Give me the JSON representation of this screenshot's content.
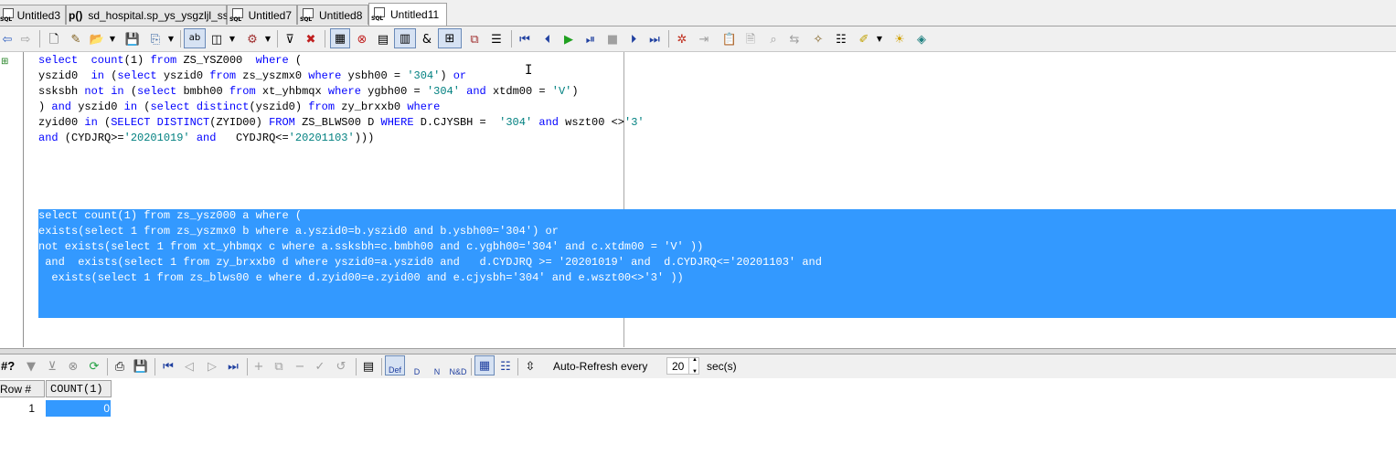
{
  "tabs": [
    {
      "label": "Untitled3",
      "icon": "sql-file-icon"
    },
    {
      "label": "sd_hospital.sp_ys_ysgzljl_ss",
      "icon": "procedure-icon",
      "icon_text": "p()"
    },
    {
      "label": "Untitled7",
      "icon": "sql-file-icon"
    },
    {
      "label": "Untitled8",
      "icon": "sql-file-icon"
    },
    {
      "label": "Untitled11",
      "icon": "sql-file-icon",
      "active": true
    }
  ],
  "sql_icon_text": "SQL",
  "editor": {
    "query1": [
      [
        {
          "t": "select  ",
          "c": "kw"
        },
        {
          "t": "count",
          "c": "fn"
        },
        {
          "t": "(1) ",
          "c": ""
        },
        {
          "t": "from",
          "c": "kw"
        },
        {
          "t": " ZS_YSZ000  ",
          "c": ""
        },
        {
          "t": "where",
          "c": "kw"
        },
        {
          "t": " (",
          "c": ""
        }
      ],
      [
        {
          "t": "yszid0  ",
          "c": ""
        },
        {
          "t": "in",
          "c": "kw"
        },
        {
          "t": " (",
          "c": ""
        },
        {
          "t": "select",
          "c": "kw"
        },
        {
          "t": " yszid0 ",
          "c": ""
        },
        {
          "t": "from",
          "c": "kw"
        },
        {
          "t": " zs_yszmx0 ",
          "c": ""
        },
        {
          "t": "where",
          "c": "kw"
        },
        {
          "t": " ysbh00 = ",
          "c": ""
        },
        {
          "t": "'304'",
          "c": "str"
        },
        {
          "t": ") ",
          "c": ""
        },
        {
          "t": "or",
          "c": "kw"
        }
      ],
      [
        {
          "t": "ssksbh ",
          "c": ""
        },
        {
          "t": "not in",
          "c": "kw"
        },
        {
          "t": " (",
          "c": ""
        },
        {
          "t": "select",
          "c": "kw"
        },
        {
          "t": " bmbh00 ",
          "c": ""
        },
        {
          "t": "from",
          "c": "kw"
        },
        {
          "t": " xt_yhbmqx ",
          "c": ""
        },
        {
          "t": "where",
          "c": "kw"
        },
        {
          "t": " ygbh00 = ",
          "c": ""
        },
        {
          "t": "'304'",
          "c": "str"
        },
        {
          "t": " ",
          "c": ""
        },
        {
          "t": "and",
          "c": "kw"
        },
        {
          "t": " xtdm00 = ",
          "c": ""
        },
        {
          "t": "'V'",
          "c": "str"
        },
        {
          "t": ")",
          "c": ""
        }
      ],
      [
        {
          "t": ") ",
          "c": ""
        },
        {
          "t": "and",
          "c": "kw"
        },
        {
          "t": " yszid0 ",
          "c": ""
        },
        {
          "t": "in",
          "c": "kw"
        },
        {
          "t": " (",
          "c": ""
        },
        {
          "t": "select distinct",
          "c": "kw"
        },
        {
          "t": "(yszid0) ",
          "c": ""
        },
        {
          "t": "from",
          "c": "kw"
        },
        {
          "t": " zy_brxxb0 ",
          "c": ""
        },
        {
          "t": "where",
          "c": "kw"
        }
      ],
      [
        {
          "t": "zyid00 ",
          "c": ""
        },
        {
          "t": "in",
          "c": "kw"
        },
        {
          "t": " (",
          "c": ""
        },
        {
          "t": "SELECT DISTINCT",
          "c": "kw"
        },
        {
          "t": "(ZYID00) ",
          "c": ""
        },
        {
          "t": "FROM",
          "c": "kw"
        },
        {
          "t": " ZS_BLWS00 D ",
          "c": ""
        },
        {
          "t": "WHERE",
          "c": "kw"
        },
        {
          "t": " D.CJYSBH =  ",
          "c": ""
        },
        {
          "t": "'304'",
          "c": "str"
        },
        {
          "t": " ",
          "c": ""
        },
        {
          "t": "and",
          "c": "kw"
        },
        {
          "t": " wszt00 <>",
          "c": ""
        },
        {
          "t": "'3'",
          "c": "str"
        }
      ],
      [
        {
          "t": "and",
          "c": "kw"
        },
        {
          "t": " (CYDJRQ>=",
          "c": ""
        },
        {
          "t": "'20201019'",
          "c": "str"
        },
        {
          "t": " ",
          "c": ""
        },
        {
          "t": "and",
          "c": "kw"
        },
        {
          "t": "   CYDJRQ<=",
          "c": ""
        },
        {
          "t": "'20201103'",
          "c": "str"
        },
        {
          "t": ")))",
          "c": ""
        }
      ]
    ],
    "query2": [
      "select count(1) from zs_ysz000 a where (",
      "exists(select 1 from zs_yszmx0 b where a.yszid0=b.yszid0 and b.ysbh00='304') or",
      "not exists(select 1 from xt_yhbmqx c where a.ssksbh=c.bmbh00 and c.ygbh00='304' and c.xtdm00 = 'V' ))",
      " and  exists(select 1 from zy_brxxb0 d where yszid0=a.yszid0 and   d.CYDJRQ >= '20201019' and  d.CYDJRQ<='20201103' and",
      "  exists(select 1 from zs_blws00 e where d.zyid00=e.zyid00 and e.cjysbh='304' and e.wszt00<>'3' ))"
    ]
  },
  "gridbar": {
    "rownum_label": "#?",
    "auto_refresh_label": "Auto-Refresh every",
    "interval_value": "20",
    "interval_unit": "sec(s)",
    "def_label": "Def",
    "d_label": "D",
    "n_label": "N",
    "nd_label": "N&D"
  },
  "grid": {
    "columns": [
      "Row  #",
      "COUNT(1)"
    ],
    "rows": [
      {
        "row": "1",
        "value": "0"
      }
    ]
  },
  "colors": {
    "keyword": "#0000ff",
    "string": "#008080",
    "selection": "#3399ff"
  }
}
